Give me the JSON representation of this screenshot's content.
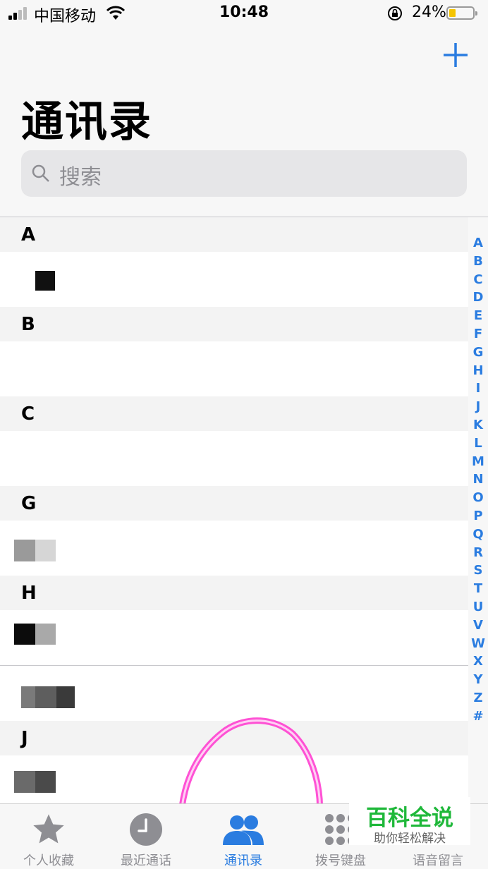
{
  "status_bar": {
    "carrier": "中国移动",
    "time": "10:48",
    "battery": "24%"
  },
  "header": {
    "title": "通讯录",
    "search_placeholder": "搜索"
  },
  "sections": [
    {
      "letter": "A"
    },
    {
      "letter": "B"
    },
    {
      "letter": "C"
    },
    {
      "letter": "G"
    },
    {
      "letter": "H"
    },
    {
      "letter": "J"
    }
  ],
  "index": [
    "A",
    "B",
    "C",
    "D",
    "E",
    "F",
    "G",
    "H",
    "I",
    "J",
    "K",
    "L",
    "M",
    "N",
    "O",
    "P",
    "Q",
    "R",
    "S",
    "T",
    "U",
    "V",
    "W",
    "X",
    "Y",
    "Z",
    "#"
  ],
  "tabs": [
    {
      "label": "个人收藏",
      "icon": "star-icon"
    },
    {
      "label": "最近通话",
      "icon": "clock-icon"
    },
    {
      "label": "通讯录",
      "icon": "contacts-icon",
      "active": true
    },
    {
      "label": "拨号键盘",
      "icon": "keypad-icon"
    },
    {
      "label": "语音留言",
      "icon": "voicemail-icon"
    }
  ],
  "watermark": {
    "title": "百科全说",
    "subtitle": "助你轻松解决"
  },
  "colors": {
    "accent": "#2a7ce0",
    "annotation": "#ff3fd0"
  }
}
